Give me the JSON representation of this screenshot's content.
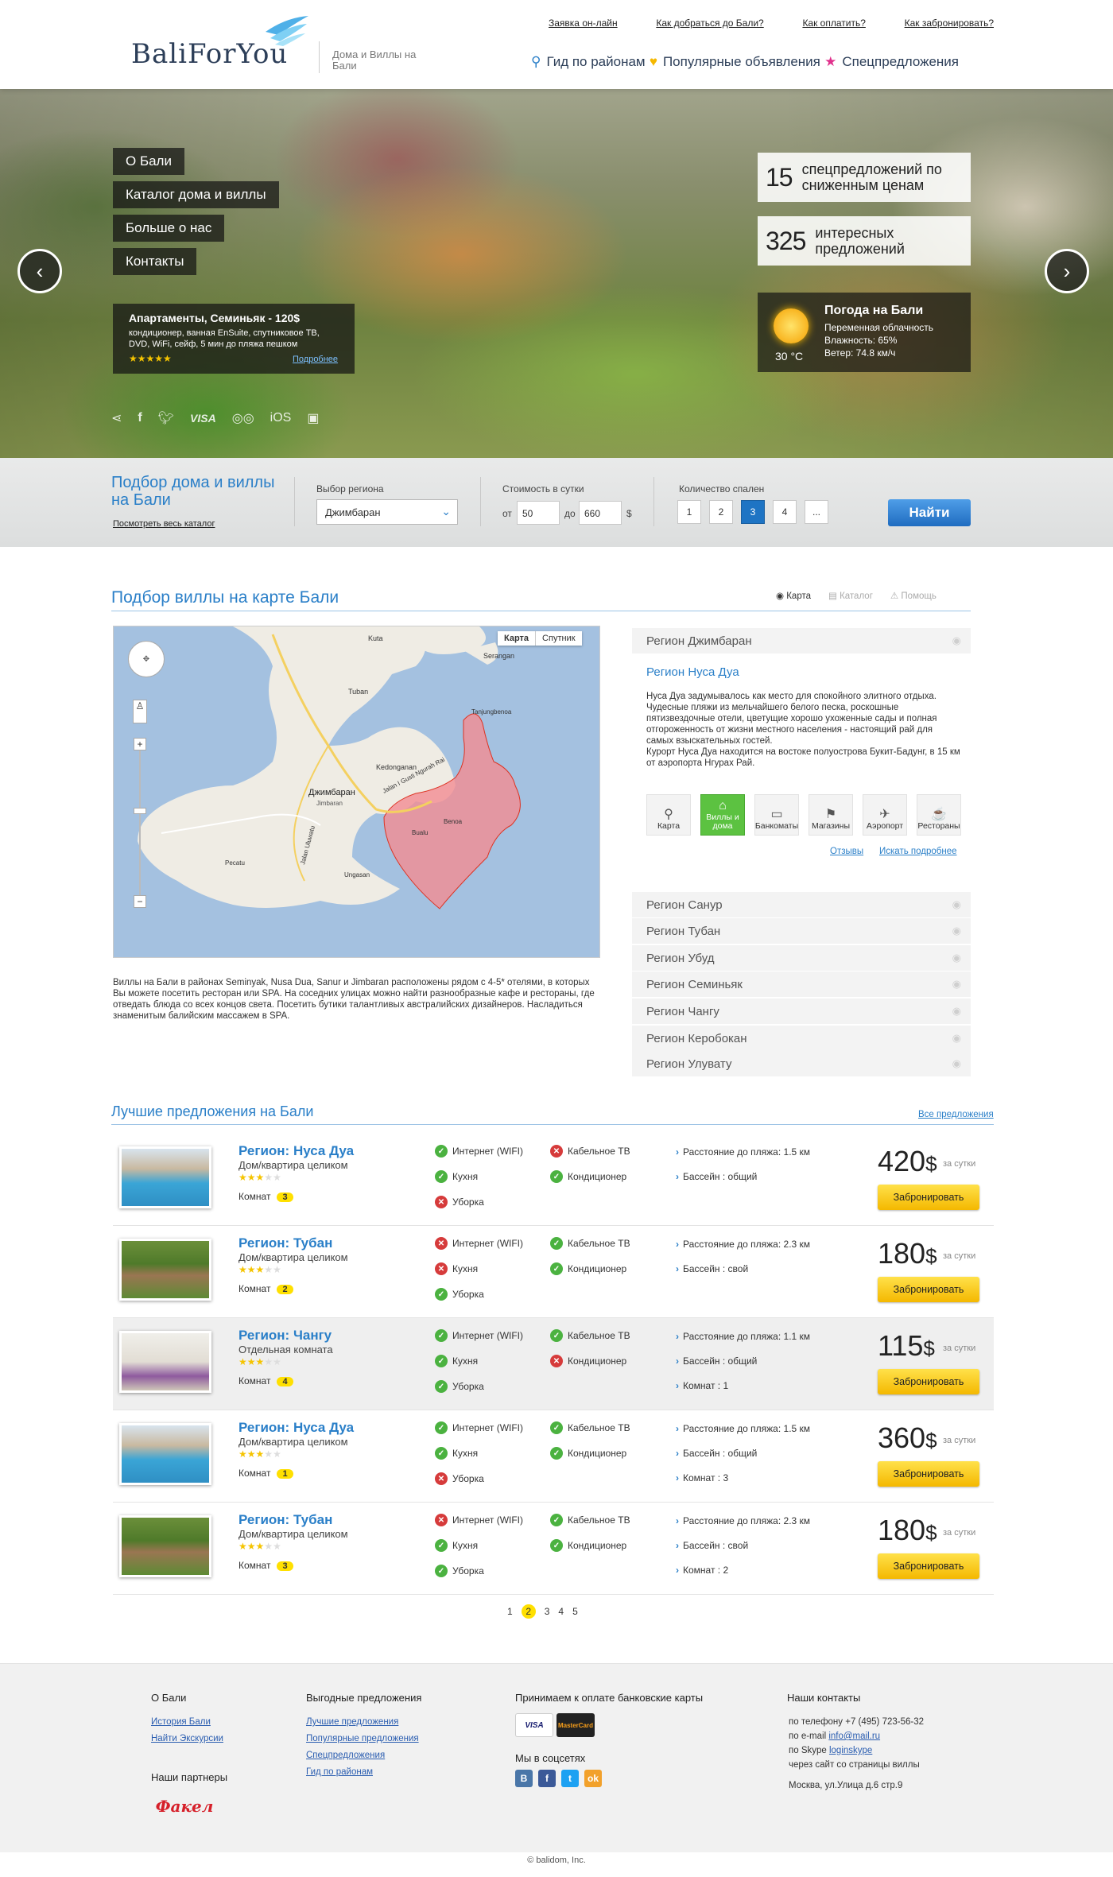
{
  "header": {
    "logo": "BaliForYou",
    "tagline": "Дома и Виллы на Бали",
    "top_links": [
      "Заявка он-лайн",
      "Как добраться до Бали?",
      "Как оплатить?",
      "Как забронировать?"
    ],
    "nav": [
      {
        "label": "Гид по районам",
        "icon": "map-pin-icon",
        "color": "#2a7fc8"
      },
      {
        "label": "Популярные объявления",
        "icon": "heart-icon",
        "color": "#f5b800"
      },
      {
        "label": "Спецпредложения",
        "icon": "star-icon",
        "color": "#e0308c"
      }
    ]
  },
  "hero": {
    "menu": [
      "О Бали",
      "Каталог дома и виллы",
      "Больше о нас",
      "Контакты"
    ],
    "apartment": {
      "title": "Апартаменты, Семиньяк - 120$",
      "desc": "кондиционер, ванная EnSuite, спутниковое ТВ, DVD, WiFi, сейф, 5 мин до пляжа пешком",
      "stars": "★★★★★",
      "more": "Подробнее"
    },
    "social": [
      "share-icon",
      "facebook-icon",
      "twitter-icon",
      "visa-icon",
      "mastercard-icon",
      "ios-icon",
      "android-icon"
    ],
    "social_labels": {
      "visa": "VISA",
      "ios": "iOS"
    },
    "stats": [
      {
        "num": "15",
        "label": "спецпредложений по сниженным ценам"
      },
      {
        "num": "325",
        "label": "интересных предложений"
      }
    ],
    "weather": {
      "title": "Погода на Бали",
      "temp": "30 °C",
      "lines": [
        "Переменная облачность",
        "Влажность: 65%",
        "Ветер: 74.8 км/ч"
      ]
    }
  },
  "search": {
    "title": "Подбор дома и виллы на Бали",
    "catalog_link": "Посмотреть весь каталог",
    "region_label": "Выбор региона",
    "region_value": "Джимбаран",
    "price_label": "Стоимость в сутки",
    "from_label": "от",
    "from_value": "50",
    "to_label": "до",
    "to_value": "660",
    "currency": "$",
    "bedrooms_label": "Количество спален",
    "bedrooms": [
      "1",
      "2",
      "3",
      "4",
      "..."
    ],
    "bedrooms_selected": "3",
    "find": "Найти"
  },
  "map_section": {
    "title": "Подбор виллы на карте Бали",
    "views": [
      "Карта",
      "Каталог",
      "Помощь"
    ],
    "map_types": [
      "Карта",
      "Спутник"
    ],
    "places": [
      "Kuta",
      "Serangan",
      "Tuban",
      "Kedonganan",
      "Tanjungbenoa",
      "Джимбаран",
      "Jimbaran",
      "Benoa",
      "Bualu",
      "Pecatu",
      "Ungasan",
      "Jalan Uluwatu",
      "Jalan I Gusti Ngurah Rai"
    ],
    "description": "Виллы на Бали в районах Seminyak, Nusa Dua, Sanur и Jimbaran расположены рядом с 4-5* отелями, в которых Вы можете посетить ресторан или SPA. На соседних улицах можно найти разнообразные кафе и рестораны, где отведать блюда со всех концов света. Посетить бутики талантливых австралийских дизайнеров. Насладиться знаменитым балийским массажем в SPA.",
    "region_top": "Регион Джимбаран",
    "open_region": {
      "title": "Регион Нуса Дуа",
      "text1": "Нуса Дуа задумывалось как место для спокойного элитного отдыха. Чудесные пляжи из мельчайшего белого песка, роскошные пятизвездочные отели, цветущие хорошо ухоженные сады и полная отгороженность от жизни местного населения - настоящий рай для самых взыскательных гостей.",
      "text2": "Курорт Нуса Дуа находится на востоке полуострова Букит-Бадунг, в 15 км от аэропорта Нгурах Рай.",
      "categories": [
        {
          "label": "Карта",
          "icon": "map-pin-icon"
        },
        {
          "label": "Виллы и дома",
          "icon": "house-icon"
        },
        {
          "label": "Банкоматы",
          "icon": "atm-icon"
        },
        {
          "label": "Магазины",
          "icon": "shop-icon"
        },
        {
          "label": "Аэропорт",
          "icon": "plane-icon"
        },
        {
          "label": "Рестораны",
          "icon": "cup-icon"
        }
      ],
      "reviews": "Отзывы",
      "search_more": "Искать подробнее"
    },
    "regions": [
      "Регион Санур",
      "Регион Тубан",
      "Регион Убуд",
      "Регион Семиньяк",
      "Регион Чангу",
      "Регион Керобокан",
      "Регион Улувату"
    ]
  },
  "offers": {
    "title": "Лучшие предложения на Бали",
    "all": "Все предложения",
    "rooms_label": "Комнат",
    "per_day": "за сутки",
    "book": "Забронировать",
    "currency": "$",
    "items": [
      {
        "title": "Регион: Нуса Дуа",
        "type": "Дом/квартира целиком",
        "rooms": "3",
        "stars": 3,
        "features": [
          [
            "ok",
            "Интернет (WIFI)"
          ],
          [
            "no",
            "Кабельное ТВ"
          ],
          [
            "ok",
            "Кухня"
          ],
          [
            "ok",
            "Кондиционер"
          ],
          [
            "no",
            "Уборка"
          ]
        ],
        "info": [
          "Расстояние до пляжа: 1.5 км",
          "Бассейн :  общий"
        ],
        "price": "420",
        "thumb": "pool"
      },
      {
        "title": "Регион: Тубан",
        "type": "Дом/квартира целиком",
        "rooms": "2",
        "stars": 3,
        "features": [
          [
            "no",
            "Интернет (WIFI)"
          ],
          [
            "ok",
            "Кабельное ТВ"
          ],
          [
            "no",
            "Кухня"
          ],
          [
            "ok",
            "Кондиционер"
          ],
          [
            "ok",
            "Уборка"
          ]
        ],
        "info": [
          "Расстояние до пляжа: 2.3 км",
          "Бассейн :  свой"
        ],
        "price": "180",
        "thumb": "garden"
      },
      {
        "title": "Регион: Чангу",
        "type": "Отдельная комната",
        "rooms": "4",
        "stars": 3,
        "features": [
          [
            "ok",
            "Интернет (WIFI)"
          ],
          [
            "ok",
            "Кабельное ТВ"
          ],
          [
            "ok",
            "Кухня"
          ],
          [
            "no",
            "Кондиционер"
          ],
          [
            "ok",
            "Уборка"
          ]
        ],
        "info": [
          "Расстояние до пляжа: 1.1 км",
          "Бассейн :  общий",
          "Комнат :  1"
        ],
        "price": "115",
        "thumb": "room"
      },
      {
        "title": "Регион: Нуса Дуа",
        "type": "Дом/квартира целиком",
        "rooms": "1",
        "stars": 3,
        "features": [
          [
            "ok",
            "Интернет (WIFI)"
          ],
          [
            "ok",
            "Кабельное ТВ"
          ],
          [
            "ok",
            "Кухня"
          ],
          [
            "ok",
            "Кондиционер"
          ],
          [
            "no",
            "Уборка"
          ]
        ],
        "info": [
          "Расстояние до пляжа: 1.5 км",
          "Бассейн :  общий",
          "Комнат :  3"
        ],
        "price": "360",
        "thumb": "pool"
      },
      {
        "title": "Регион: Тубан",
        "type": "Дом/квартира целиком",
        "rooms": "3",
        "stars": 3,
        "features": [
          [
            "no",
            "Интернет (WIFI)"
          ],
          [
            "ok",
            "Кабельное ТВ"
          ],
          [
            "ok",
            "Кухня"
          ],
          [
            "ok",
            "Кондиционер"
          ],
          [
            "ok",
            "Уборка"
          ]
        ],
        "info": [
          "Расстояние до пляжа: 2.3 км",
          "Бассейн :  свой",
          "Комнат :  2"
        ],
        "price": "180",
        "thumb": "garden"
      }
    ],
    "pages": [
      "1",
      "2",
      "3",
      "4",
      "5"
    ],
    "current_page": "2"
  },
  "footer": {
    "col1_title": "О Бали",
    "col1_links": [
      "История Бали",
      "Найти Экскурсии"
    ],
    "partners_title": "Наши партнеры",
    "partner": "Факел",
    "col2_title": "Выгодные предложения",
    "col2_links": [
      "Лучшие предложения",
      "Популярные предложения",
      "Спецпредложения",
      "Гид по районам"
    ],
    "col3_title": "Принимаем к оплате банковские карты",
    "cards": [
      "VISA",
      "MasterCard"
    ],
    "social_title": "Мы в соцсетях",
    "socials": [
      {
        "icon": "vk-icon",
        "glyph": "В",
        "color": "#4a76a8"
      },
      {
        "icon": "facebook-icon",
        "glyph": "f",
        "color": "#3b5998"
      },
      {
        "icon": "twitter-icon",
        "glyph": "t",
        "color": "#1da1f2"
      },
      {
        "icon": "odnoklassniki-icon",
        "glyph": "ok",
        "color": "#f2a12b"
      }
    ],
    "col4_title": "Наши контакты",
    "phone": "по телефону +7 (495) 723-56-32",
    "email_label": "по e-mail ",
    "email": "info@mail.ru",
    "skype_label": "по Skype ",
    "skype": "loginskype",
    "site": "через сайт со страницы виллы",
    "address": "Москва, ул.Улица д.6 стр.9",
    "copyright": "© balidom, Inc."
  }
}
